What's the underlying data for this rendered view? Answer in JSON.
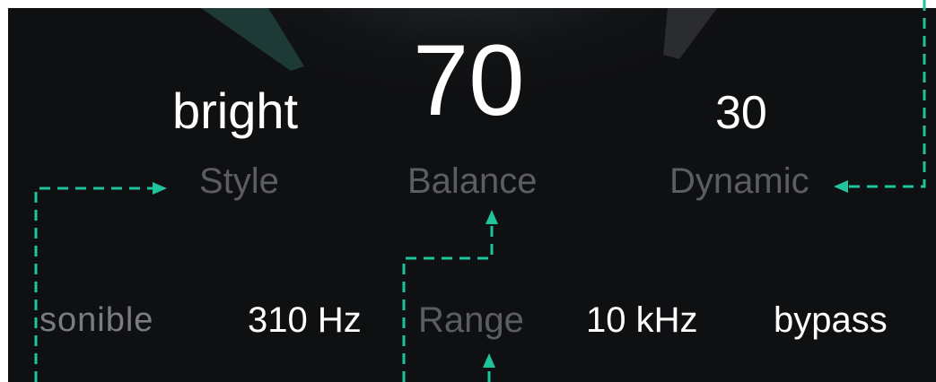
{
  "colors": {
    "background": "#0f1012",
    "value_text": "#ffffff",
    "label_text": "#5b5d60",
    "accent": "#1fc49c",
    "knob_ring": "#1e3a36"
  },
  "controls": {
    "style": {
      "value": "bright",
      "label": "Style"
    },
    "balance": {
      "value": "70",
      "label": "Balance"
    },
    "dynamic": {
      "value": "30",
      "label": "Dynamic"
    }
  },
  "bottom_bar": {
    "logo": "sonible",
    "low_freq": "310 Hz",
    "range_label": "Range",
    "high_freq": "10 kHz",
    "bypass": "bypass"
  },
  "icons": [
    "annotation-arrow-icon"
  ]
}
